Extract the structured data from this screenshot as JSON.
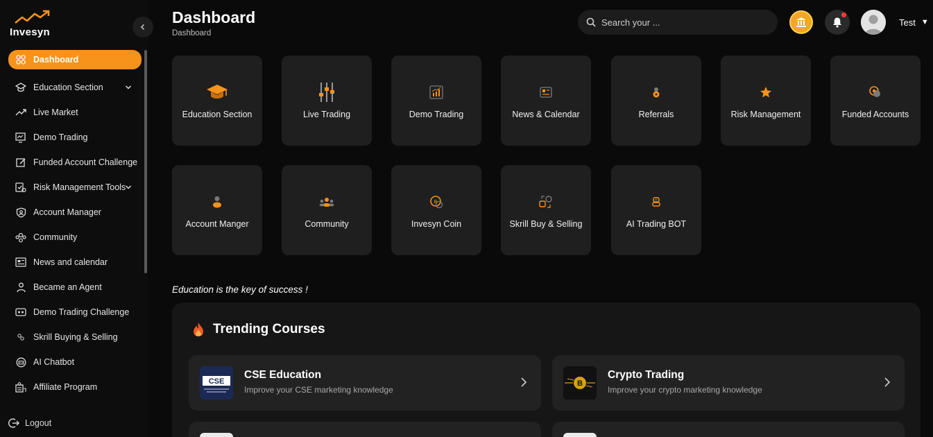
{
  "app": {
    "name": "Invesyn"
  },
  "header": {
    "title": "Dashboard",
    "breadcrumb": "Dashboard",
    "search_placeholder": "Search your ...",
    "user_name": "Test"
  },
  "sidebar": {
    "items": [
      {
        "label": "Dashboard",
        "icon": "grid-icon",
        "active": true
      },
      {
        "label": "Education Section",
        "icon": "graduation-icon",
        "has_submenu": true
      },
      {
        "label": "Live Market",
        "icon": "trend-line-icon"
      },
      {
        "label": "Demo Trading",
        "icon": "monitor-chart-icon"
      },
      {
        "label": "Funded Account Challenge",
        "icon": "edit-box-icon"
      },
      {
        "label": "Risk Management Tools",
        "icon": "shield-check-icon",
        "has_submenu": true
      },
      {
        "label": "Account Manager",
        "icon": "user-shield-icon"
      },
      {
        "label": "Community",
        "icon": "community-icon"
      },
      {
        "label": "News and calendar",
        "icon": "newspaper-icon"
      },
      {
        "label": "Became an Agent",
        "icon": "agent-icon"
      },
      {
        "label": "Demo Trading Challenge",
        "icon": "challenge-icon"
      },
      {
        "label": "Skrill Buying & Selling",
        "icon": "exchange-icon"
      },
      {
        "label": "AI Chatbot",
        "icon": "robot-icon"
      },
      {
        "label": "Affiliate Program",
        "icon": "affiliate-icon"
      }
    ],
    "logout_label": "Logout"
  },
  "tiles": [
    {
      "label": "Education Section",
      "icon": "graduation-cap-icon"
    },
    {
      "label": "Live Trading",
      "icon": "sliders-icon"
    },
    {
      "label": "Demo Trading",
      "icon": "chart-box-icon"
    },
    {
      "label": "News & Calendar",
      "icon": "news-icon"
    },
    {
      "label": "Referrals",
      "icon": "referral-icon"
    },
    {
      "label": "Risk Management",
      "icon": "star-icon"
    },
    {
      "label": "Funded Accounts",
      "icon": "coins-icon"
    },
    {
      "label": "Account Manger",
      "icon": "person-icon"
    },
    {
      "label": "Community",
      "icon": "group-icon"
    },
    {
      "label": "Invesyn Coin",
      "icon": "coin-icon"
    },
    {
      "label": "Skrill Buy & Selling",
      "icon": "swap-icon"
    },
    {
      "label": "AI Trading BOT",
      "icon": "bot-icon"
    }
  ],
  "tagline": "Education is the key of success !",
  "trending": {
    "title": "Trending Courses",
    "courses": [
      {
        "title": "CSE Education",
        "subtitle": "Improve your CSE marketing knowledge",
        "thumb_text": "CSE"
      },
      {
        "title": "Crypto Trading",
        "subtitle": "Improve your crypto marketing knowledge",
        "thumb_text": "B"
      }
    ]
  },
  "colors": {
    "accent": "#f7931a",
    "background": "#0a0a0a",
    "tile": "#1f1f1f",
    "notification": "#ff3b30"
  }
}
